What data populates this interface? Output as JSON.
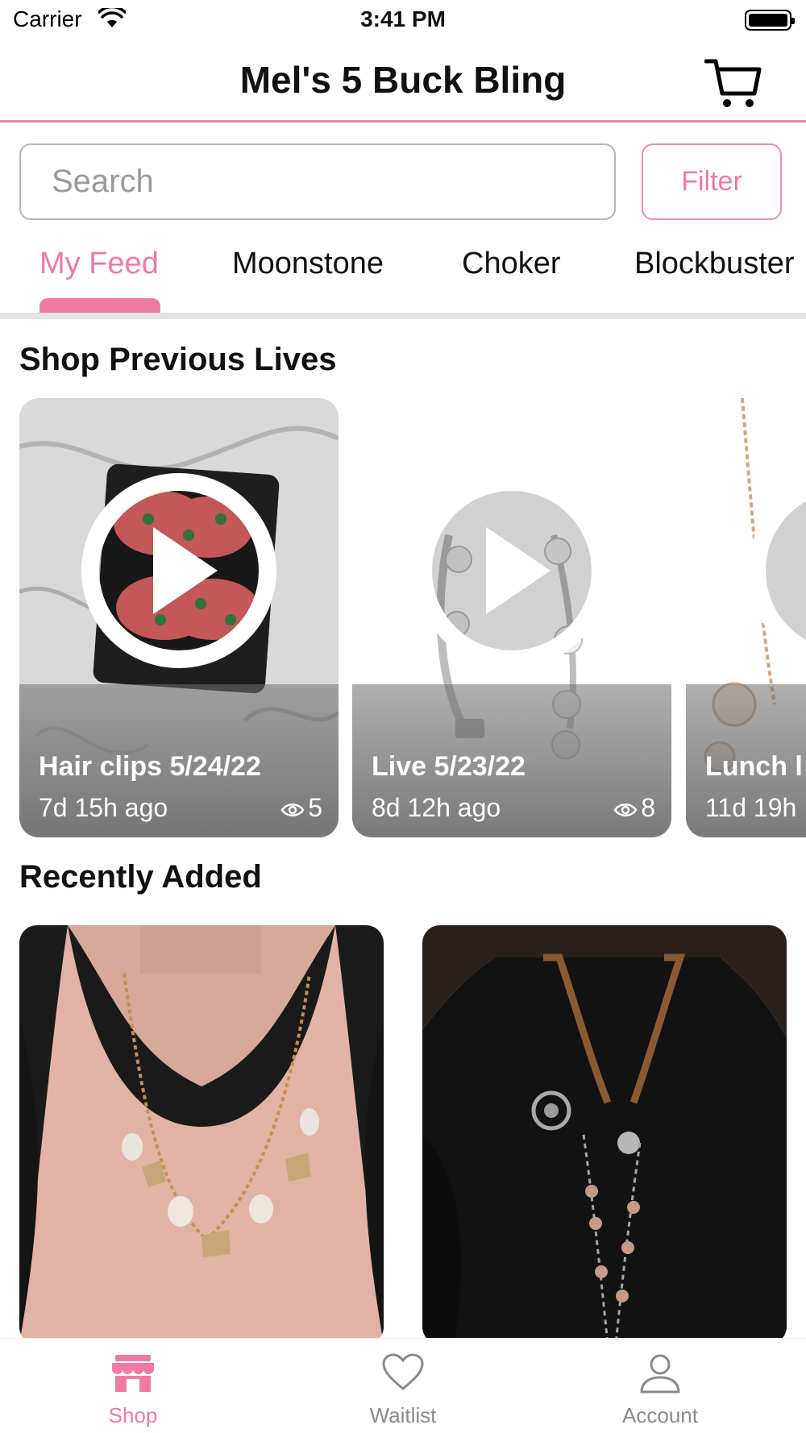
{
  "status_bar": {
    "carrier": "Carrier",
    "time": "3:41 PM"
  },
  "header": {
    "title": "Mel's 5 Buck Bling"
  },
  "search": {
    "placeholder": "Search",
    "value": ""
  },
  "filter_label": "Filter",
  "tabs": [
    {
      "label": "My Feed",
      "active": true
    },
    {
      "label": "Moonstone"
    },
    {
      "label": "Choker"
    },
    {
      "label": "Blockbuster"
    }
  ],
  "sections": {
    "previous_lives": "Shop Previous Lives",
    "recently_added": "Recently Added"
  },
  "lives": [
    {
      "title": "Hair clips 5/24/22",
      "ago": "7d 15h ago",
      "views": "5"
    },
    {
      "title": "Live 5/23/22",
      "ago": "8d 12h ago",
      "views": "8"
    },
    {
      "title": "Lunch l",
      "ago": "11d 19h",
      "views": ""
    }
  ],
  "products": [
    {
      "icon": "necklace-photo"
    },
    {
      "icon": "necklace-photo"
    }
  ],
  "nav": [
    {
      "label": "Shop",
      "icon": "shop-icon",
      "active": true
    },
    {
      "label": "Waitlist",
      "icon": "heart-icon"
    },
    {
      "label": "Account",
      "icon": "account-icon"
    }
  ],
  "colors": {
    "accent": "#f07aa3",
    "divider": "#ee86aa"
  }
}
